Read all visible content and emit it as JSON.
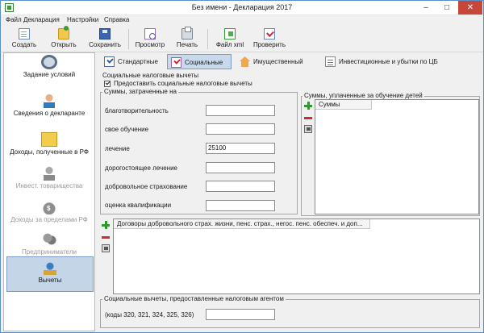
{
  "window": {
    "title": "Без имени - Декларация 2017",
    "min_glyph": "–",
    "max_glyph": "□",
    "close_glyph": "✕"
  },
  "menu": [
    "Файл",
    "Декларация",
    "Настройки",
    "Справка"
  ],
  "toolbar": {
    "create": "Создать",
    "open": "Открыть",
    "save": "Сохранить",
    "preview": "Просмотр",
    "print": "Печать",
    "xml": "Файл xml",
    "check": "Проверить"
  },
  "sidebar": {
    "items": [
      {
        "label": "Задание условий",
        "icon": "gear-icon",
        "state": "normal"
      },
      {
        "label": "Сведения о декларанте",
        "icon": "person-icon",
        "state": "normal"
      },
      {
        "label": "Доходы, полученные в РФ",
        "icon": "folders-icon",
        "state": "normal"
      },
      {
        "label": "Инвест. товарищества",
        "icon": "investor-icon",
        "state": "disabled"
      },
      {
        "label": "Доходы за пределами РФ",
        "icon": "money-bag-icon",
        "state": "disabled"
      },
      {
        "label": "Предприниматели",
        "icon": "entrepreneurs-icon",
        "state": "disabled"
      },
      {
        "label": "Вычеты",
        "icon": "deductions-icon",
        "state": "active"
      }
    ]
  },
  "tabs": [
    {
      "label": "Стандартные",
      "icon": "standard-icon",
      "active": false
    },
    {
      "label": "Социальные",
      "icon": "social-icon",
      "active": true
    },
    {
      "label": "Имущественный",
      "icon": "house-icon",
      "active": false
    },
    {
      "label": "Инвестиционные и убытки по ЦБ",
      "icon": "investment-icon",
      "active": false
    }
  ],
  "social": {
    "section_title": "Социальные налоговые вычеты",
    "provide_checkbox": "Предоставить социальные налоговые вычеты",
    "provide_checked": true,
    "spent_title": "Суммы, затраченные на",
    "fields": [
      {
        "label": "благотворительность",
        "value": ""
      },
      {
        "label": "свое обучение",
        "value": ""
      },
      {
        "label": "лечение",
        "value": "25100"
      },
      {
        "label": "дорогостоящее лечение",
        "value": ""
      },
      {
        "label": "добровольное страхование",
        "value": ""
      },
      {
        "label": "оценка квалификации",
        "value": ""
      }
    ],
    "children_title": "Суммы, уплаченные за обучение детей",
    "children_column": "Суммы",
    "contracts_column": "Договоры добровольного страх. жизни, пенс. страх., негос. пенс. обеспеч. и доп...",
    "agent_title": "Социальные вычеты, предоставленные налоговым агентом",
    "agent_label": "(коды 320, 321, 324, 325, 326)",
    "agent_value": ""
  }
}
